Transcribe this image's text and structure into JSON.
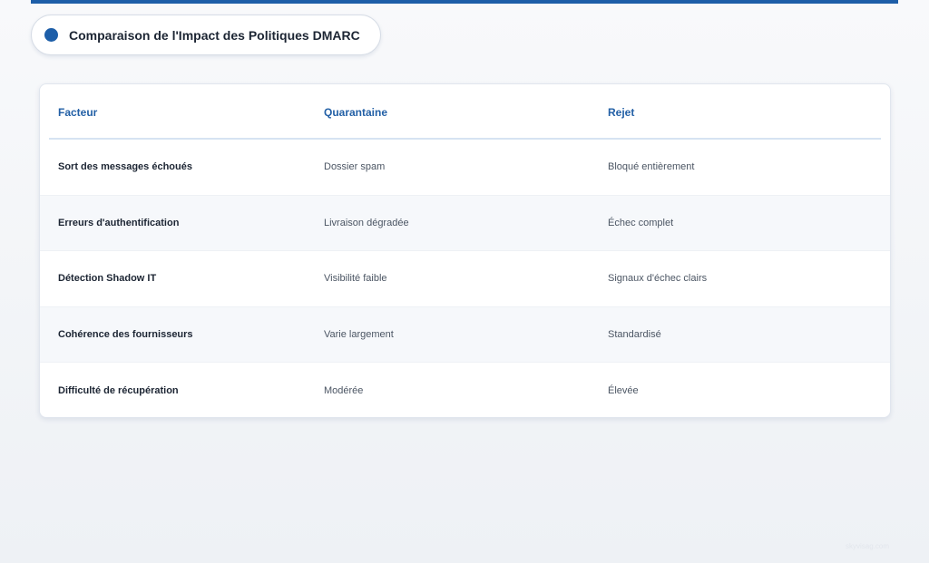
{
  "title": "Comparaison de l'Impact des Politiques DMARC",
  "colors": {
    "accent": "#1d5ea8",
    "header_text": "#2360a6",
    "alt_row": "#f6f8fb"
  },
  "table": {
    "headers": [
      "Facteur",
      "Quarantaine",
      "Rejet"
    ],
    "rows": [
      [
        "Sort des messages échoués",
        "Dossier spam",
        "Bloqué entièrement"
      ],
      [
        "Erreurs d'authentification",
        "Livraison dégradée",
        "Échec complet"
      ],
      [
        "Détection Shadow IT",
        "Visibilité faible",
        "Signaux d'échec clairs"
      ],
      [
        "Cohérence des fournisseurs",
        "Varie largement",
        "Standardisé"
      ],
      [
        "Difficulté de récupération",
        "Modérée",
        "Élevée"
      ]
    ]
  },
  "watermark": "skyvisag.com"
}
